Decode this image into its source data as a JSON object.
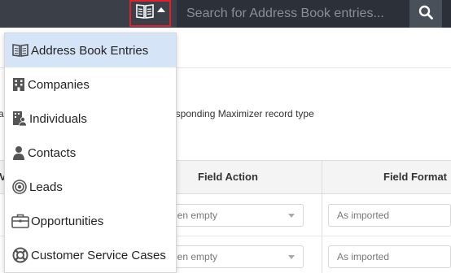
{
  "topbar": {
    "module_icon": "address-book-icon",
    "search_placeholder": "Search for Address Book entries...",
    "search_icon": "search-icon"
  },
  "background": {
    "description_lead": "a",
    "description_tail": "esponding Maximizer record type",
    "columns": [
      {
        "label": "V"
      },
      {
        "label": "Field Action"
      },
      {
        "label": "Field Format"
      }
    ],
    "rows": [
      {
        "action": "hen empty",
        "format": "As imported"
      },
      {
        "action": "hen empty",
        "format": "As imported"
      }
    ]
  },
  "dropdown": {
    "items": [
      {
        "label": "Address Book Entries",
        "icon": "address-book-icon",
        "active": true
      },
      {
        "label": "Companies",
        "icon": "building-icon"
      },
      {
        "label": "Individuals",
        "icon": "individual-icon"
      },
      {
        "label": "Contacts",
        "icon": "person-icon"
      },
      {
        "label": "Leads",
        "icon": "target-icon"
      },
      {
        "label": "Opportunities",
        "icon": "briefcase-icon"
      },
      {
        "label": "Customer Service Cases",
        "icon": "lifebuoy-icon"
      }
    ]
  }
}
